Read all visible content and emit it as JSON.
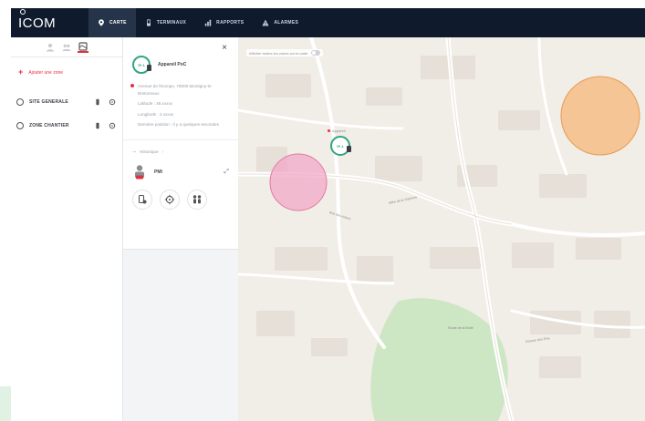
{
  "app": {
    "logo": "ICOM"
  },
  "nav": {
    "tabs": [
      {
        "label": "CARTE",
        "icon": "map-pin-icon",
        "active": true
      },
      {
        "label": "TERMINAUX",
        "icon": "device-icon",
        "active": false
      },
      {
        "label": "RAPPORTS",
        "icon": "chart-icon",
        "active": false
      },
      {
        "label": "ALARMES",
        "icon": "alarm-icon",
        "active": false
      }
    ]
  },
  "sidebar": {
    "add_zone_label": "Ajouter une zone",
    "sites": [
      {
        "name": "SITE GENERALE"
      },
      {
        "name": "ZONE CHANTIER"
      }
    ]
  },
  "panel": {
    "device_id": "IP-1",
    "device_name": "Appareil PoC",
    "address": "Avenue de l'Europe, 78000 Montigny-le-Bretonneux",
    "latitude": "Latitude : 48.xxxxx",
    "longitude": "Longitude : 2.xxxxx",
    "last_position": "Dernière position : il y a quelques secondes",
    "history_label": "Historique",
    "feature_label": "PMI"
  },
  "map": {
    "toggle_label": "Afficher toutes les zones sur la carte",
    "marker_tag": "Appareil",
    "marker_id": "IP-1",
    "streets": [
      "Rue des Arbres",
      "Allée de la Garenne",
      "Route de la Butte",
      "Avenue des Pins"
    ],
    "colors": {
      "pink_zone": "#f1a8c7",
      "orange_zone": "#f6b77a",
      "park": "#cde6c4",
      "accent": "#33a680",
      "danger": "#e5313f"
    }
  }
}
